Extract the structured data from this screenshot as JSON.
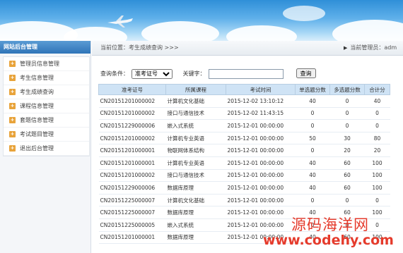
{
  "sidebar": {
    "title": "网站后台管理",
    "items": [
      {
        "label": "管理员信息管理"
      },
      {
        "label": "考生信息管理"
      },
      {
        "label": "考生成绩查询"
      },
      {
        "label": "课程信息管理"
      },
      {
        "label": "套题信息管理"
      },
      {
        "label": "考试题目管理"
      },
      {
        "label": "退出后台管理"
      }
    ]
  },
  "breadcrumb": {
    "text": "当前位置：考生成绩查询 >>>",
    "admin_label": "当前管理员：adm"
  },
  "search": {
    "condition_label": "查询条件：",
    "condition_value": "准考证号",
    "keyword_label": "关键字：",
    "keyword_value": "",
    "button_label": "查询"
  },
  "table": {
    "headers": [
      "准考证号",
      "所属课程",
      "考试时间",
      "单选题分数",
      "多选题分数",
      "合计分"
    ],
    "rows": [
      [
        "CN20151201000002",
        "计算机文化基础",
        "2015-12-02 13:10:12",
        "40",
        "0",
        "40"
      ],
      [
        "CN20151201000002",
        "接口与通信技术",
        "2015-12-02 11:43:15",
        "0",
        "0",
        "0"
      ],
      [
        "CN20151229000006",
        "嵌入式系统",
        "2015-12-01 00:00:00",
        "0",
        "0",
        "0"
      ],
      [
        "CN20151201000002",
        "计算机专业英语",
        "2015-12-01 00:00:00",
        "50",
        "30",
        "80"
      ],
      [
        "CN20151201000001",
        "物联网体系结构",
        "2015-12-01 00:00:00",
        "0",
        "20",
        "20"
      ],
      [
        "CN20151201000001",
        "计算机专业英语",
        "2015-12-01 00:00:00",
        "40",
        "60",
        "100"
      ],
      [
        "CN20151201000002",
        "接口与通信技术",
        "2015-12-01 00:00:00",
        "40",
        "60",
        "100"
      ],
      [
        "CN20151229000006",
        "数据库原理",
        "2015-12-01 00:00:00",
        "40",
        "60",
        "100"
      ],
      [
        "CN20151225000007",
        "计算机文化基础",
        "2015-12-01 00:00:00",
        "0",
        "0",
        "0"
      ],
      [
        "CN20151225000007",
        "数据库原理",
        "2015-12-01 00:00:00",
        "40",
        "60",
        "100"
      ],
      [
        "CN20151225000005",
        "嵌入式系统",
        "2015-12-01 00:00:00",
        "0",
        "0",
        "0"
      ],
      [
        "CN20151201000001",
        "数据库原理",
        "2015-12-01 00:00:00",
        "40",
        "60",
        "100"
      ]
    ]
  },
  "watermark": {
    "line1": "源码海洋网",
    "line2": "www.codehy.com"
  },
  "icons": {
    "menu": "plus-square-icon",
    "breadcrumb": "triangle-right-icon"
  },
  "colors": {
    "menu_icon": "#e8a33a",
    "header_bg": "#cfe3f5",
    "sidebar_title": "#2f74b8",
    "watermark": "#e53b2c"
  }
}
